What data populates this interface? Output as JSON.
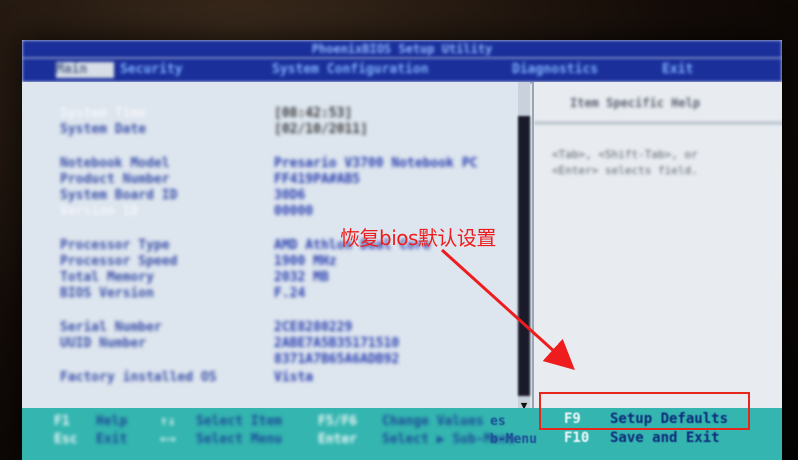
{
  "bios": {
    "tabs": [
      {
        "label": "Main"
      },
      {
        "label": "Security"
      },
      {
        "label": "System Configuration"
      },
      {
        "label": "Diagnostics"
      },
      {
        "label": "Exit"
      }
    ],
    "title": "PhoenixBIOS Setup Utility",
    "main_fields": [
      {
        "label": "System Time",
        "value": "[08:42:53]"
      },
      {
        "label": "System Date",
        "value": "[02/10/2011]"
      },
      {
        "label": "Notebook Model",
        "value": "Presario V3700 Notebook PC"
      },
      {
        "label": "Product Number",
        "value": "FF419PA#AB5"
      },
      {
        "label": "System Board ID",
        "value": "30D6"
      },
      {
        "label": "Version ID",
        "value": "00000"
      },
      {
        "label": "Processor Type",
        "value": "AMD Athlon Dual Core"
      },
      {
        "label": "Processor Speed",
        "value": "1900 MHz"
      },
      {
        "label": "Total Memory",
        "value": "2032 MB"
      },
      {
        "label": "BIOS Version",
        "value": "F.24"
      },
      {
        "label": "Serial Number",
        "value": "2CE8280229"
      },
      {
        "label": "UUID Number",
        "value": "2ABE7A5B35171510"
      },
      {
        "label": "",
        "value": "8371A7B65A6ADB92"
      },
      {
        "label": "Factory installed OS",
        "value": "Vista"
      }
    ],
    "help": {
      "title": "Item Specific Help",
      "lines": [
        "<Tab>, <Shift-Tab>, or",
        "<Enter> selects field."
      ]
    },
    "footer": [
      {
        "key": "F1",
        "desc": "Help"
      },
      {
        "key": "Esc",
        "desc": "Exit"
      },
      {
        "key": "↑↓",
        "desc": "Select Item"
      },
      {
        "key": "←→",
        "desc": "Select Menu"
      },
      {
        "key": "F5/F6",
        "desc": "Change Values"
      },
      {
        "key": "Enter",
        "desc": "Select ▶ Sub-Menu"
      },
      {
        "key": "F9",
        "desc": "Setup Defaults"
      },
      {
        "key": "F10",
        "desc": "Save and Exit"
      }
    ],
    "footer_visible": {
      "upper": "es",
      "lower": "b-Menu"
    },
    "scroll_arrow": "▼"
  },
  "annotation": {
    "text": "恢复bios默认设置",
    "color": "#ee1c1c"
  },
  "colors": {
    "header_blue": "#1a2f9a",
    "footer_teal": "#34b5b0",
    "label_blue": "#3a4fa8"
  }
}
